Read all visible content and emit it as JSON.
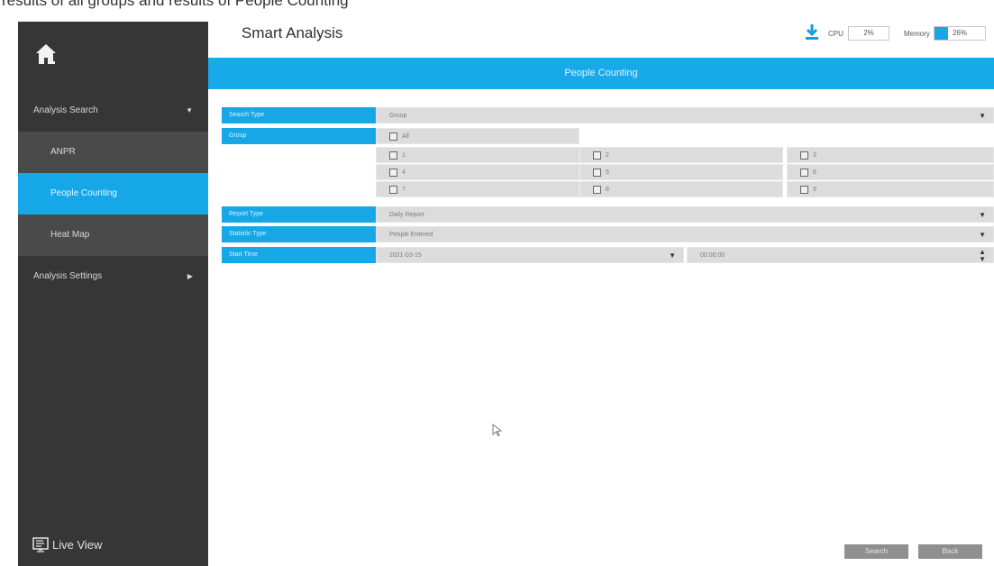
{
  "caption_fragment": "results of all groups and results of People Counting",
  "sidebar": {
    "items": [
      {
        "label": "Analysis Search",
        "type": "parent",
        "arrow": "▼"
      },
      {
        "label": "ANPR",
        "type": "child"
      },
      {
        "label": "People Counting",
        "type": "child-active"
      },
      {
        "label": "Heat Map",
        "type": "child"
      },
      {
        "label": "Analysis Settings",
        "type": "parent",
        "arrow": "▶"
      }
    ],
    "live_view_label": "Live View"
  },
  "header": {
    "title": "Smart Analysis",
    "cpu_label": "CPU",
    "cpu_value": "2%",
    "memory_label": "Memory",
    "memory_value": "26%",
    "memory_fill_percent": 26,
    "accent_color": "#17a9e8"
  },
  "page": {
    "banner_title": "People Counting",
    "search_type_label": "Search Type",
    "search_type_value": "Group",
    "group_label": "Group",
    "group_all": "All",
    "groups": [
      "1",
      "2",
      "3",
      "4",
      "5",
      "6",
      "7",
      "8",
      "9"
    ],
    "report_type_label": "Report Type",
    "report_type_value": "Daily Report",
    "statistic_type_label": "Statistic Type",
    "statistic_type_value": "People Entered",
    "start_time_label": "Start Time",
    "start_date_value": "2021-03-15",
    "start_time_value": "00:00:00",
    "search_button": "Search",
    "back_button": "Back"
  }
}
